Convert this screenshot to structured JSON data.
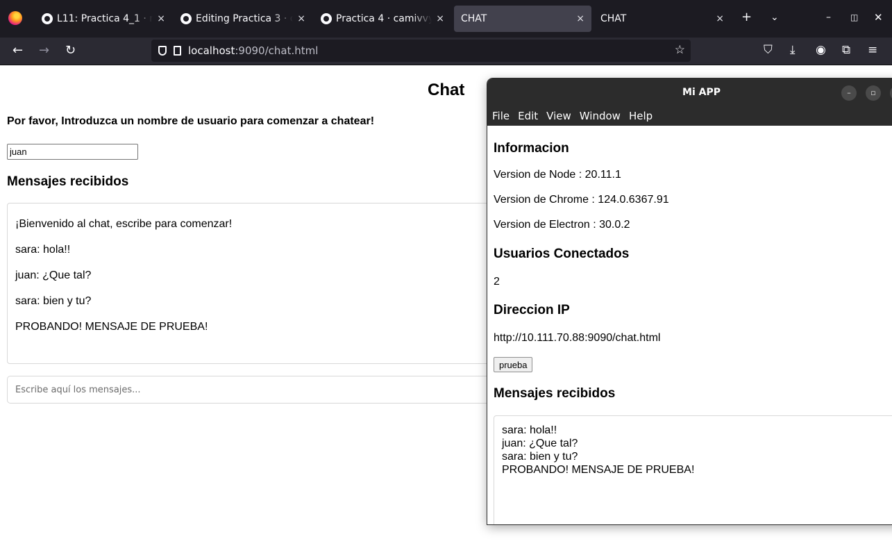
{
  "browser": {
    "tabs": [
      {
        "title": "L11: Practica 4_1 · m",
        "close": "×",
        "active": false,
        "github": true
      },
      {
        "title": "Editing Practica 3 · c",
        "close": "×",
        "active": false,
        "github": true
      },
      {
        "title": "Practica 4 · camivvy/",
        "close": "×",
        "active": false,
        "github": true
      },
      {
        "title": "CHAT",
        "close": "×",
        "active": true,
        "github": false
      },
      {
        "title": "CHAT",
        "close": "×",
        "active": false,
        "github": false
      }
    ],
    "url_host": "localhost",
    "url_rest": ":9090/chat.html"
  },
  "page": {
    "title": "Chat",
    "prompt": "Por favor, Introduzca un nombre de usuario para comenzar a chatear!",
    "username_value": "juan",
    "received_heading": "Mensajes recibidos",
    "messages": [
      "¡Bienvenido al chat, escribe para comenzar!",
      "sara: hola!!",
      "juan: ¿Que tal?",
      "sara: bien y tu?",
      "PROBANDO! MENSAJE DE PRUEBA!"
    ],
    "compose_placeholder": "Escribe aquí los mensajes..."
  },
  "app": {
    "window_title": "Mi APP",
    "menu": [
      "File",
      "Edit",
      "View",
      "Window",
      "Help"
    ],
    "info_heading": "Informacion",
    "node_version": "Version de Node : 20.11.1",
    "chrome_version": "Version de Chrome : 124.0.6367.91",
    "electron_version": "Version de Electron : 30.0.2",
    "users_heading": "Usuarios Conectados",
    "users_count": "2",
    "ip_heading": "Direccion IP",
    "ip_value": "http://10.111.70.88:9090/chat.html",
    "button_label": "prueba",
    "received_heading": "Mensajes recibidos",
    "messages": [
      "sara: hola!!",
      "juan: ¿Que tal?",
      "sara: bien y tu?",
      "PROBANDO! MENSAJE DE PRUEBA!"
    ]
  }
}
